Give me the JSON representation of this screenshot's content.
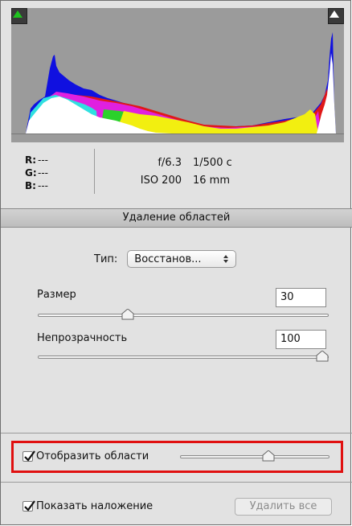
{
  "histogram": {
    "clip_shadow_icon": "triangle-up-icon",
    "clip_highlight_icon": "triangle-up-icon",
    "clip_shadow_color": "#1fc21f",
    "clip_highlight_color": "#ffffff"
  },
  "rgb_readout": [
    {
      "label": "R:",
      "value": "---"
    },
    {
      "label": "G:",
      "value": "---"
    },
    {
      "label": "B:",
      "value": "---"
    }
  ],
  "exif": {
    "aperture": "f/6.3",
    "shutter": "1/500 с",
    "iso": "ISO 200",
    "focal": "16 mm"
  },
  "section_title": "Удаление областей",
  "type": {
    "label": "Тип:",
    "value": "Восстанов...",
    "icon": "updown-arrows-icon"
  },
  "size": {
    "label": "Размер",
    "value": "30",
    "slider_fraction": 0.3
  },
  "opacity": {
    "label": "Непрозрачность",
    "value": "100",
    "slider_fraction": 1.0
  },
  "show_areas": {
    "label": "Отобразить области",
    "checked": true,
    "slider_fraction": 0.6
  },
  "show_overlay": {
    "label": "Показать наложение",
    "checked": true
  },
  "delete_all_label": "Удалить все",
  "colors": {
    "highlight_box": "#e01010",
    "panel_bg": "#e2e2e2"
  }
}
